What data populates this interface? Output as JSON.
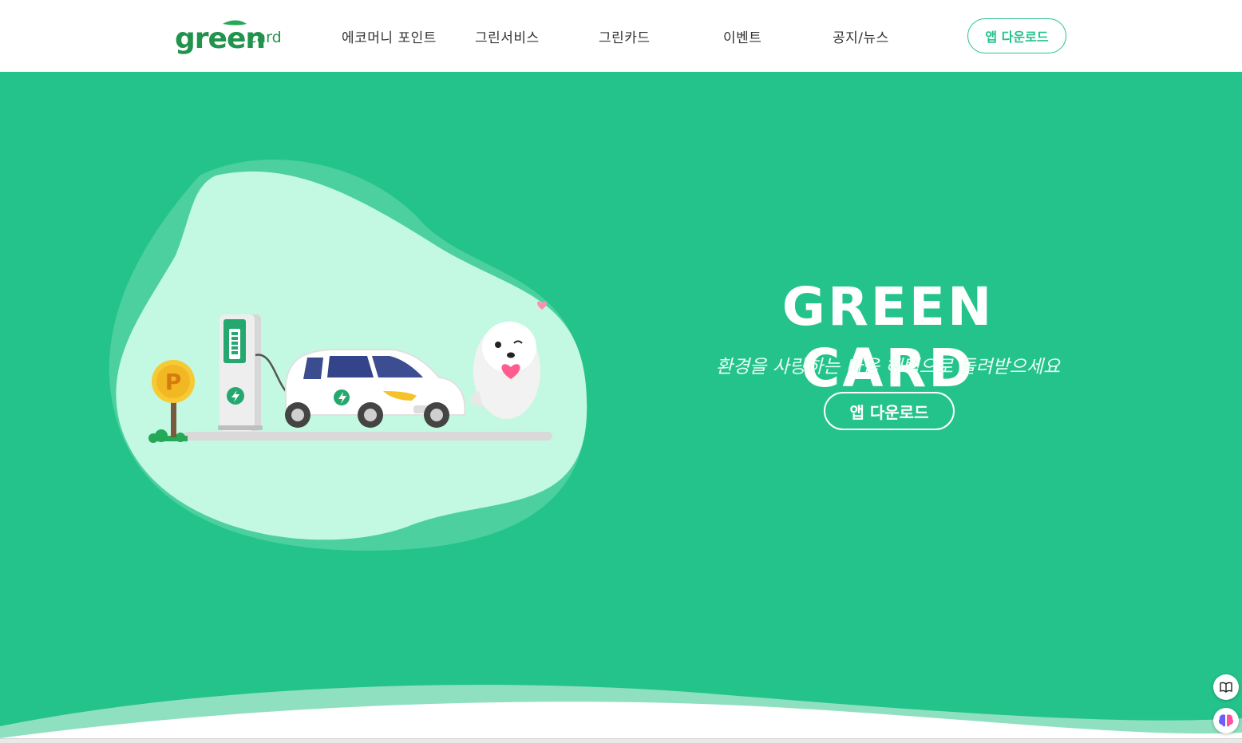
{
  "header": {
    "logo_text": "greencard",
    "nav": [
      {
        "label": "에코머니 포인트"
      },
      {
        "label": "그린서비스"
      },
      {
        "label": "그린카드"
      },
      {
        "label": "이벤트"
      },
      {
        "label": "공지/뉴스"
      }
    ],
    "download_button": "앱 다운로드"
  },
  "hero": {
    "title": "GREEN CARD",
    "subtitle": "환경을 사랑하는 마음 혜택으로 돌려받으세요",
    "download_button": "앱 다운로드",
    "parking_sign_letter": "P"
  },
  "floating": {
    "icons": [
      "book-icon",
      "brain-icon"
    ]
  },
  "colors": {
    "brand_green": "#25c38c",
    "blob_light": "#c3f9e2",
    "blob_mid": "#4dd0a0"
  }
}
